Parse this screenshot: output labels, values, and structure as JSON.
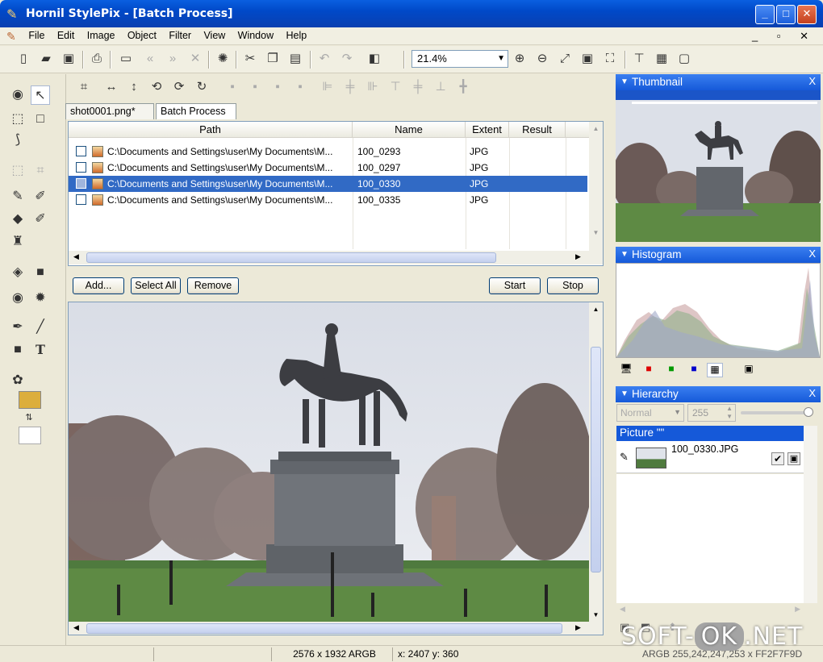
{
  "window": {
    "title": "Hornil StylePix - [Batch Process]"
  },
  "menu": [
    "File",
    "Edit",
    "Image",
    "Object",
    "Filter",
    "View",
    "Window",
    "Help"
  ],
  "toolbar": {
    "zoom": "21.4%"
  },
  "tabs": [
    "shot0001.png*",
    "Batch Process"
  ],
  "batch": {
    "columns": [
      "Path",
      "Name",
      "Extent",
      "Result"
    ],
    "rows": [
      {
        "path": "C:\\Documents and Settings\\user\\My Documents\\M...",
        "name": "100_0293",
        "ext": "JPG",
        "result": ""
      },
      {
        "path": "C:\\Documents and Settings\\user\\My Documents\\M...",
        "name": "100_0297",
        "ext": "JPG",
        "result": ""
      },
      {
        "path": "C:\\Documents and Settings\\user\\My Documents\\M...",
        "name": "100_0330",
        "ext": "JPG",
        "result": ""
      },
      {
        "path": "C:\\Documents and Settings\\user\\My Documents\\M...",
        "name": "100_0335",
        "ext": "JPG",
        "result": ""
      }
    ],
    "selected_row": 2,
    "buttons": {
      "add": "Add...",
      "select_all": "Select All",
      "remove": "Remove",
      "start": "Start",
      "stop": "Stop"
    }
  },
  "panels": {
    "thumbnail": {
      "title": "Thumbnail",
      "close": "X"
    },
    "histogram": {
      "title": "Histogram",
      "close": "X"
    },
    "hierarchy": {
      "title": "Hierarchy",
      "close": "X",
      "blend_mode": "Normal",
      "opacity": "255",
      "picture_label": "Picture \"\"",
      "layer_name": "100_0330.JPG"
    }
  },
  "status": {
    "dimensions": "2576 x 1932 ARGB",
    "coords": "x: 2407 y: 360",
    "color": "ARGB 255,242,247,253 x FF2F7F9D"
  },
  "watermark": {
    "left": "SOFT-",
    "mid": "OK",
    "right": ".NET"
  },
  "colors": {
    "title_bar": "#0049c8",
    "selection": "#316ac5",
    "panel_header": "#1559d9",
    "foreground": "#dcae3c",
    "background": "#ffffff"
  }
}
